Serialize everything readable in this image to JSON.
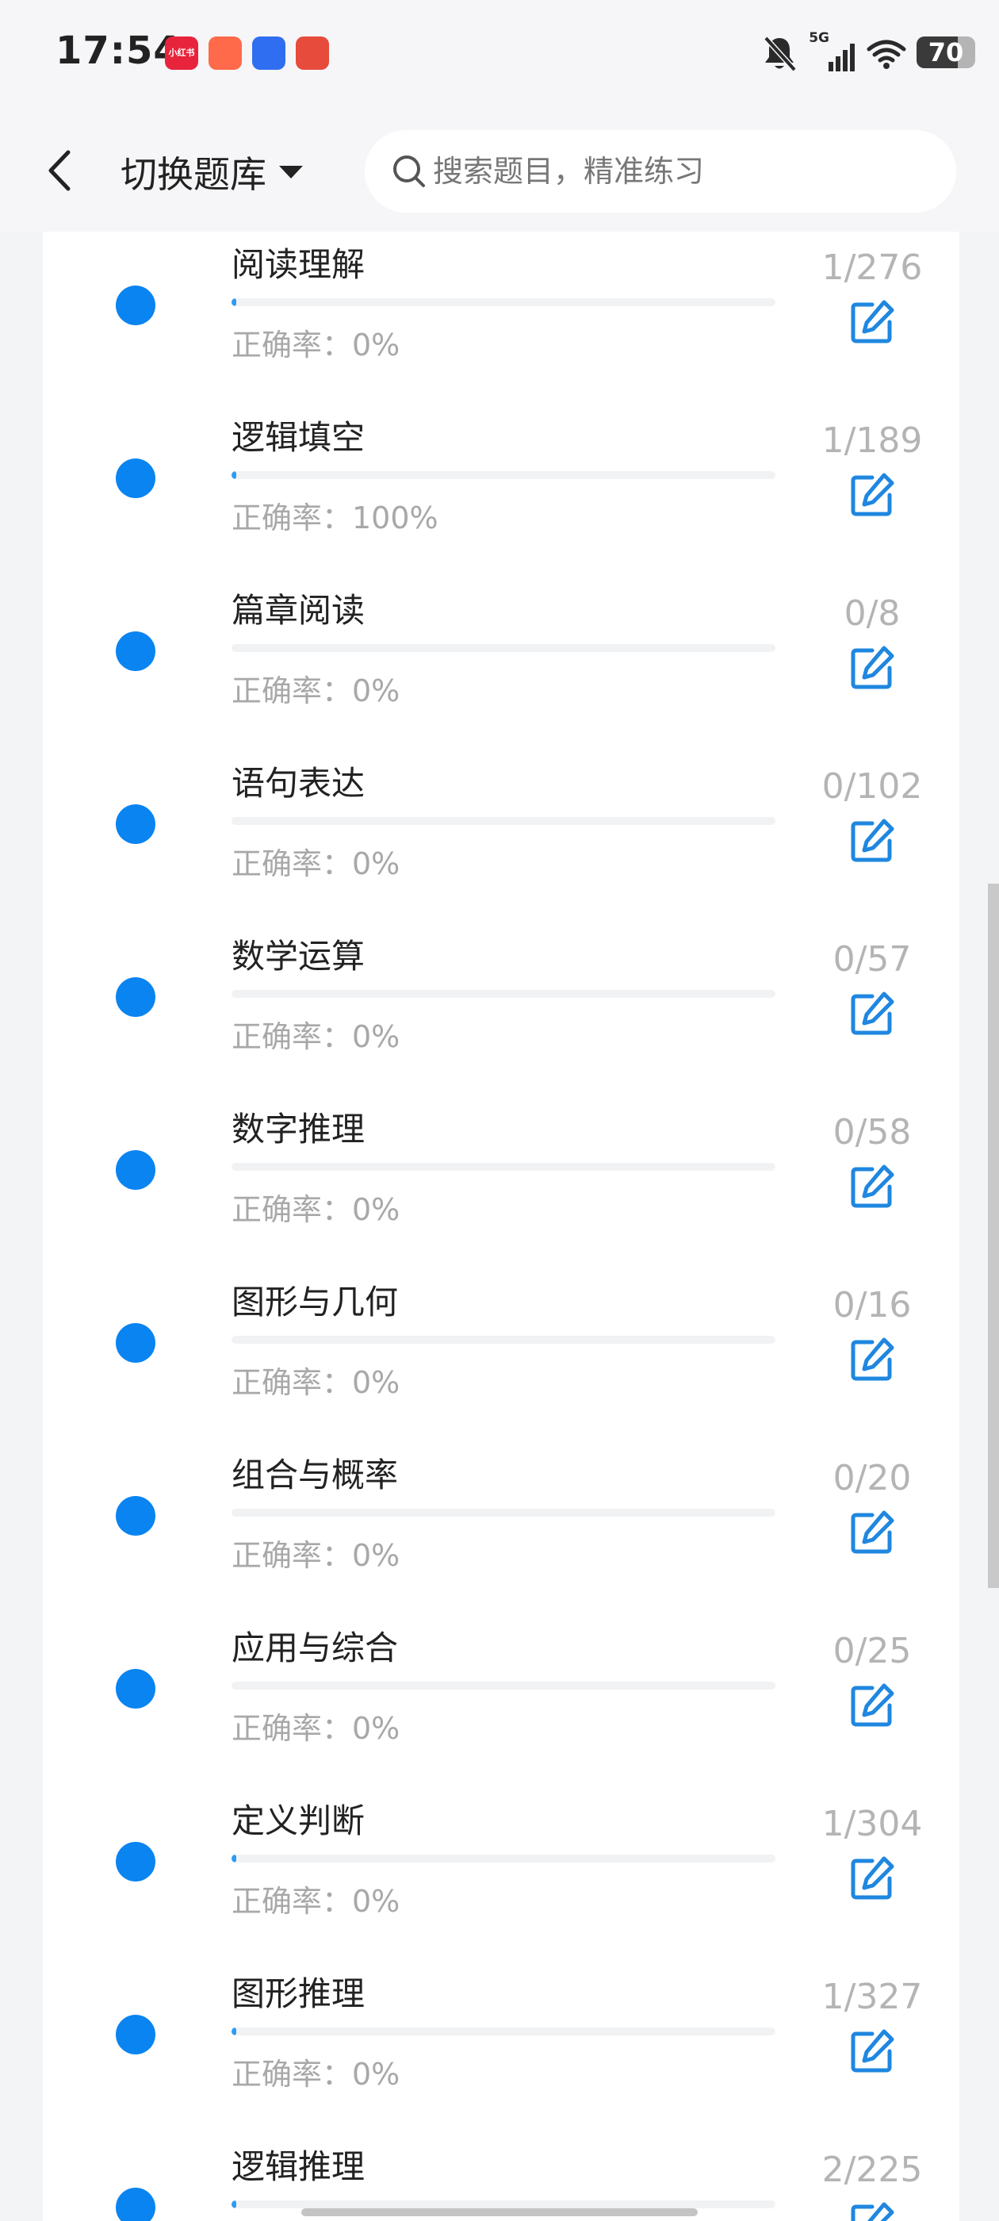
{
  "status_bar": {
    "time": "17:54",
    "network": "5G",
    "battery": "70",
    "battery_level": 0.7,
    "app_icons": [
      {
        "name": "xiaohongshu-app-icon",
        "label": "小红书",
        "color": "#e8243c"
      },
      {
        "name": "camping-app-icon",
        "label": "",
        "color": "#ff6a4a"
      },
      {
        "name": "shield-app-icon",
        "label": "",
        "color": "#2f6ef0"
      },
      {
        "name": "pizza-app-icon",
        "label": "",
        "color": "#e64b3c"
      }
    ]
  },
  "header": {
    "title": "切换题库",
    "search_placeholder": "搜索题目，精准练习"
  },
  "colors": {
    "accent": "#0a84f0",
    "progress": "#2f9bf0",
    "edit_icon": "#1f87e0",
    "muted_text": "#a8a8a8"
  },
  "items": [
    {
      "title": "阅读理解",
      "accuracy": "正确率：0%",
      "count": "1/276",
      "progress": 0.004
    },
    {
      "title": "逻辑填空",
      "accuracy": "正确率：100%",
      "count": "1/189",
      "progress": 0.005
    },
    {
      "title": "篇章阅读",
      "accuracy": "正确率：0%",
      "count": "0/8",
      "progress": 0
    },
    {
      "title": "语句表达",
      "accuracy": "正确率：0%",
      "count": "0/102",
      "progress": 0
    },
    {
      "title": "数学运算",
      "accuracy": "正确率：0%",
      "count": "0/57",
      "progress": 0
    },
    {
      "title": "数字推理",
      "accuracy": "正确率：0%",
      "count": "0/58",
      "progress": 0
    },
    {
      "title": "图形与几何",
      "accuracy": "正确率：0%",
      "count": "0/16",
      "progress": 0
    },
    {
      "title": "组合与概率",
      "accuracy": "正确率：0%",
      "count": "0/20",
      "progress": 0
    },
    {
      "title": "应用与综合",
      "accuracy": "正确率：0%",
      "count": "0/25",
      "progress": 0
    },
    {
      "title": "定义判断",
      "accuracy": "正确率：0%",
      "count": "1/304",
      "progress": 0.003
    },
    {
      "title": "图形推理",
      "accuracy": "正确率：0%",
      "count": "1/327",
      "progress": 0.003
    },
    {
      "title": "逻辑推理",
      "accuracy": "",
      "count": "2/225",
      "progress": 0.009
    }
  ]
}
